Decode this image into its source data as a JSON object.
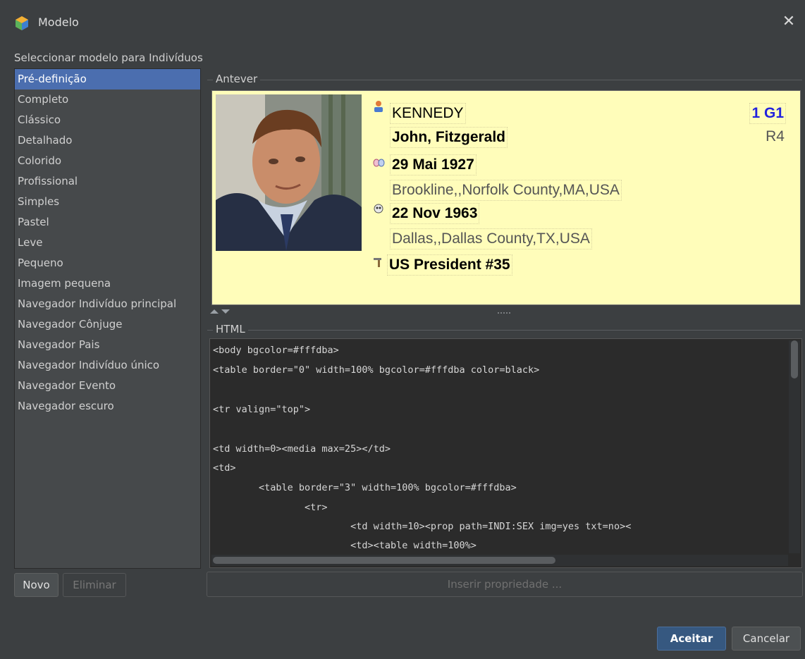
{
  "window": {
    "title": "Modelo",
    "close_icon": "close-icon"
  },
  "subtitle": "Seleccionar modelo para Indivíduos",
  "templates": [
    "Pré-definição",
    "Completo",
    "Clássico",
    "Detalhado",
    "Colorido",
    "Profissional",
    "Simples",
    "Pastel",
    "Leve",
    "Pequeno",
    "Imagem pequena",
    "Navegador Indivíduo principal",
    "Navegador Cônjuge",
    "Navegador Pais",
    "Navegador Indivíduo único",
    "Navegador Evento",
    "Navegador escuro"
  ],
  "selected_template": "Pré-definição",
  "buttons": {
    "new": "Novo",
    "delete": "Eliminar",
    "accept": "Aceitar",
    "cancel": "Cancelar"
  },
  "preview": {
    "label": "Antever",
    "surname": "KENNEDY",
    "given": "John, Fitzgerald",
    "id": "1 G1",
    "ref": "R4",
    "birth_date": "29 Mai 1927",
    "birth_place": "Brookline,,Norfolk County,MA,USA",
    "death_date": "22 Nov 1963",
    "death_place": "Dallas,,Dallas County,TX,USA",
    "occupation": "US President #35",
    "background": "#fffdba"
  },
  "html_editor": {
    "label": "HTML",
    "lines": [
      "<body bgcolor=#fffdba>",
      "<table border=\"0\" width=100% bgcolor=#fffdba color=black>",
      "",
      "<tr valign=\"top\">",
      "",
      "<td width=0><media max=25></td>",
      "<td>",
      "        <table border=\"3\" width=100% bgcolor=#fffdba>",
      "                <tr>",
      "                        <td width=10><prop path=INDI:SEX img=yes txt=no><",
      "                        <td><table width=100%>"
    ]
  },
  "insert_property": "Inserir propriedade ..."
}
